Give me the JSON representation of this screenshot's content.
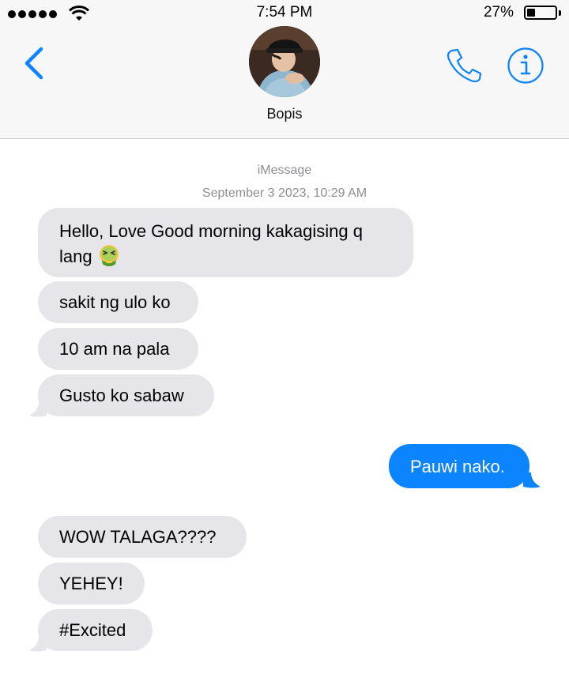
{
  "status_bar": {
    "time": "7:54 PM",
    "battery_percent": "27%",
    "battery_level": 0.27,
    "signal_bars": 5
  },
  "header": {
    "contact_name": "Bopis",
    "back_icon": "chevron-left-icon",
    "call_icon": "phone-icon",
    "info_icon": "info-icon",
    "accent_color": "#0b84fe"
  },
  "thread": {
    "service_label": "iMessage",
    "timestamp": "September 3 2023, 10:29 AM",
    "messages": [
      {
        "direction": "incoming",
        "line1": "Hello, Love Good morning kakagising q",
        "line2": "lang",
        "emoji": "nauseated-face-icon"
      },
      {
        "direction": "incoming",
        "text": "sakit ng ulo ko"
      },
      {
        "direction": "incoming",
        "text": "10 am na pala"
      },
      {
        "direction": "incoming",
        "text": "Gusto ko sabaw"
      },
      {
        "direction": "outgoing",
        "text": "Pauwi nako."
      },
      {
        "direction": "incoming",
        "text": "WOW TALAGA????"
      },
      {
        "direction": "incoming",
        "text": "YEHEY!"
      },
      {
        "direction": "incoming",
        "text": "#Excited"
      }
    ],
    "incoming_bubble_color": "#e5e5ea",
    "outgoing_bubble_color": "#0b84fe"
  }
}
